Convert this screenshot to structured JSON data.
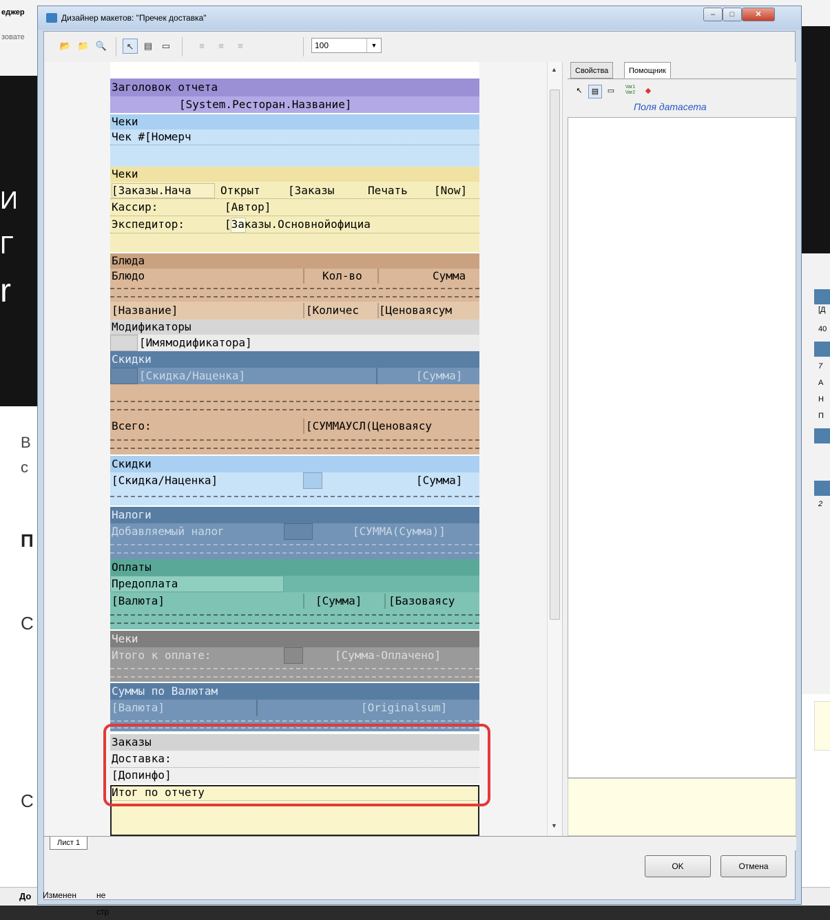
{
  "background": {
    "top_left_label_1": "еджер",
    "top_left_label_2": "зовате",
    "left_big_1": "И",
    "left_big_2": "Г",
    "left_big_3": "r",
    "left_mid_1": "В",
    "left_mid_2": "с",
    "left_mid_3": "П",
    "left_mid_4": "С",
    "left_mid_5": "С",
    "right_t1": "[Д",
    "right_t2": "40",
    "right_t3": "7",
    "right_t4": "А",
    "right_t5": "Н",
    "right_t6": "П",
    "right_t7": "2"
  },
  "window": {
    "title": "Дизайнер макетов: \"Пречек доставка\"",
    "min": "–",
    "max": "□",
    "close": "✕"
  },
  "toolbar": {
    "zoom_value": "100"
  },
  "right_panel": {
    "tabs": [
      "Свойства",
      "Помощник"
    ],
    "active_tab": "Помощник",
    "var_label_1": "Var1",
    "var_label_2": "Var2",
    "dataset_link": "Поля датасета"
  },
  "report": {
    "header_title": "Заголовок отчета",
    "header_field": "[System.Ресторан.Название]",
    "checks_1_title": "Чеки",
    "check_num": "Чек #[Номерч",
    "checks_2_title": "Чеки",
    "orders_start": "[Заказы.Нача",
    "opened": "Открыт",
    "orders_2": "[Заказы",
    "print": "Печать",
    "now": "[Now]",
    "cashier_label": "Кассир:",
    "cashier_value": "[Автор]",
    "expeditor_label": "Экспедитор:",
    "expeditor_value": "[Заказы.Основнойофициа",
    "dishes_title": "Блюда",
    "dish_col": "Блюдо",
    "qty_col": "Кол-во",
    "sum_col": "Сумма",
    "name_field": "[Название]",
    "qty_field": "[Количес",
    "price_field": "[Ценоваясум",
    "modifiers_title": "Модификаторы",
    "modifier_field": "[Имямодификатора]",
    "discounts_1_title": "Скидки",
    "discount_field_1": "[Скидка/Наценка]",
    "discount_sum_1": "[Сумма]",
    "total_label": "Всего:",
    "total_value": "[СУММАУСЛ(Ценоваясу",
    "discounts_2_title": "Скидки",
    "discount_field_2": "[Скидка/Наценка]",
    "discount_sum_2": "[Сумма]",
    "taxes_title": "Налоги",
    "tax_label": "Добавляемый налог",
    "tax_value": "[СУММА(Сумма)]",
    "payments_title": "Оплаты",
    "prepay": "Предоплата",
    "currency_field": "[Валюта]",
    "pay_sum": "[Сумма]",
    "base_sum": "[Базоваясу",
    "checks_3_title": "Чеки",
    "to_pay_label": "Итого к оплате:",
    "to_pay_value": "[Сумма-Оплачено]",
    "by_currency_title": "Суммы по Валютам",
    "currency_field_2": "[Валюта]",
    "original_sum": "[Originalsum]",
    "orders_title": "Заказы",
    "delivery_label": "Доставка:",
    "addinfo": "[Допинфо]",
    "report_total": "Итог по отчету"
  },
  "sheet_tab": "Лист 1",
  "buttons": {
    "ok": "OK",
    "cancel": "Отмена"
  },
  "status": {
    "left": "До",
    "changed": "Изменен",
    "page": "не стр"
  }
}
